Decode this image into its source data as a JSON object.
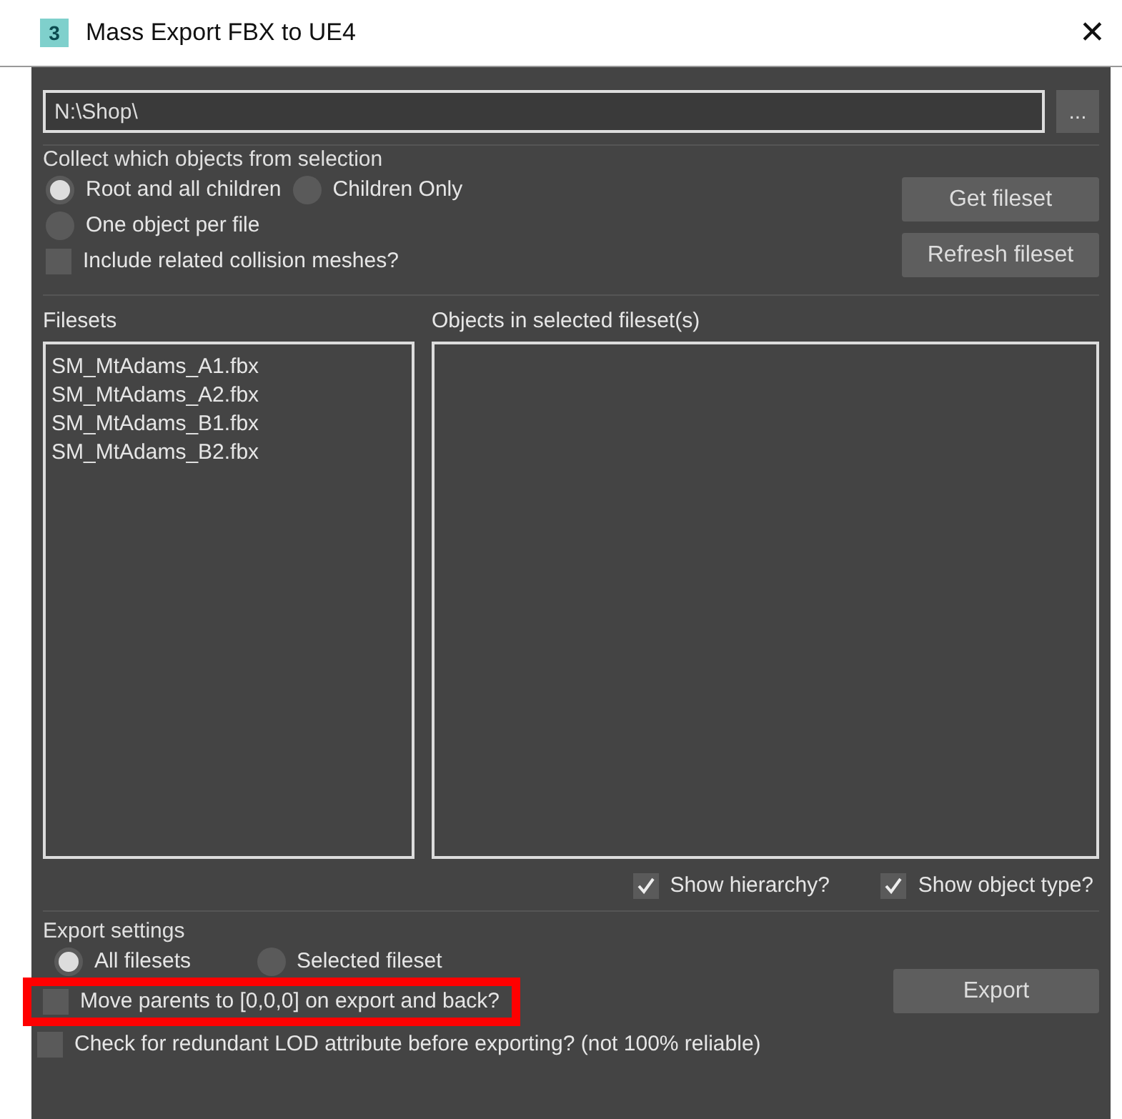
{
  "window": {
    "title": "Mass Export FBX to UE4",
    "icon_label": "3",
    "close": "✕"
  },
  "path": {
    "value": "N:\\Shop\\",
    "browse_button": "..."
  },
  "collect": {
    "title": "Collect which objects from selection",
    "modes": [
      {
        "label": "Root and all children",
        "selected": true
      },
      {
        "label": "Children Only",
        "selected": false
      },
      {
        "label": "One object per file",
        "selected": false
      }
    ],
    "include_collision": {
      "label": "Include related collision meshes?",
      "checked": false
    },
    "buttons": [
      "Get fileset",
      "Refresh fileset"
    ]
  },
  "filesets": {
    "title": "Filesets",
    "items": [
      "SM_MtAdams_A1.fbx",
      "SM_MtAdams_A2.fbx",
      "SM_MtAdams_B1.fbx",
      "SM_MtAdams_B2.fbx"
    ]
  },
  "objects": {
    "title": "Objects in selected fileset(s)"
  },
  "view_options": [
    {
      "label": "Show hierarchy?",
      "checked": true
    },
    {
      "label": "Show object type?",
      "checked": true
    }
  ],
  "export_settings": {
    "title": "Export settings",
    "scope": [
      {
        "label": "All filesets",
        "selected": true
      },
      {
        "label": "Selected fileset",
        "selected": false
      }
    ],
    "options": [
      {
        "label": "Move parents to [0,0,0] on export and back?",
        "checked": false,
        "highlighted": true
      },
      {
        "label": "Check for redundant LOD attribute before exporting? (not 100% reliable)",
        "checked": false,
        "highlighted": false
      }
    ],
    "export_button": "Export"
  }
}
